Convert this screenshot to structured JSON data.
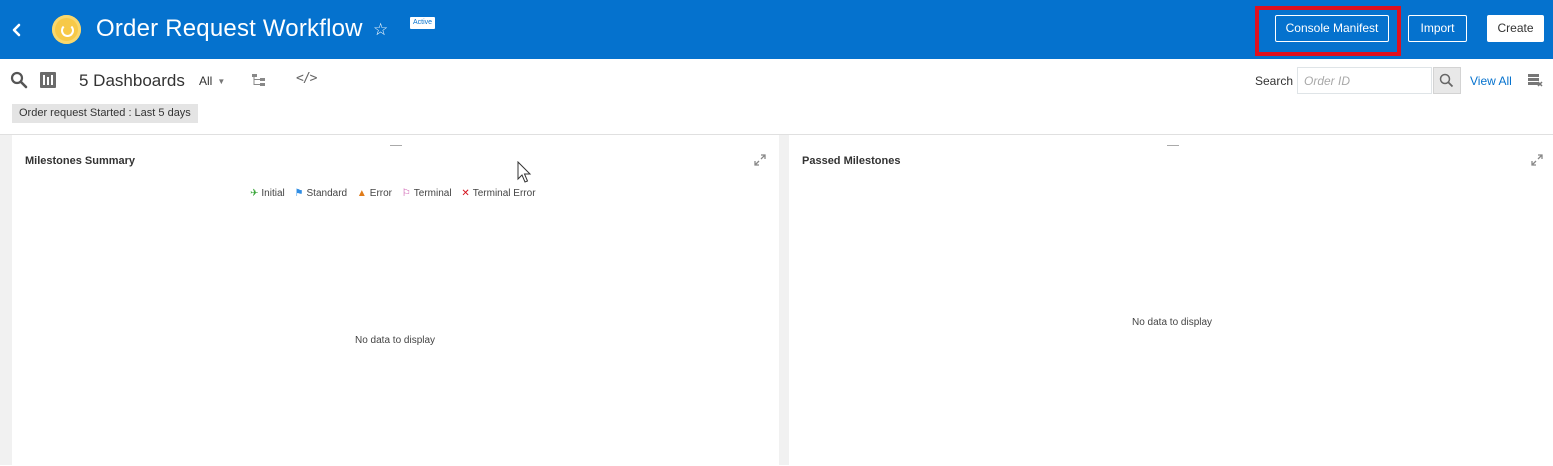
{
  "header": {
    "title": "Order Request Workflow",
    "status_badge": "Active",
    "buttons": {
      "console_manifest": "Console Manifest",
      "import": "Import",
      "create": "Create"
    },
    "colors": {
      "background": "#0572ce",
      "highlight": "#e0101e",
      "logo": "#f7c948"
    }
  },
  "toolbar": {
    "dashboards_count": "5 Dashboards",
    "filter_dropdown": "All",
    "search_label": "Search",
    "search_placeholder": "Order ID",
    "view_all": "View All",
    "filter_chip": "Order request Started : Last 5 days"
  },
  "panels": {
    "left": {
      "title": "Milestones Summary",
      "legend": [
        {
          "label": "Initial",
          "icon": "pin-icon",
          "color": "#3aa63a"
        },
        {
          "label": "Standard",
          "icon": "flag-icon",
          "color": "#2f8de4"
        },
        {
          "label": "Error",
          "icon": "warning-icon",
          "color": "#e07c1a"
        },
        {
          "label": "Terminal",
          "icon": "checkered-flag-icon",
          "color": "#c43ca0"
        },
        {
          "label": "Terminal Error",
          "icon": "x-icon",
          "color": "#d3121d"
        }
      ],
      "empty_message": "No data to display"
    },
    "right": {
      "title": "Passed Milestones",
      "empty_message": "No data to display"
    }
  }
}
